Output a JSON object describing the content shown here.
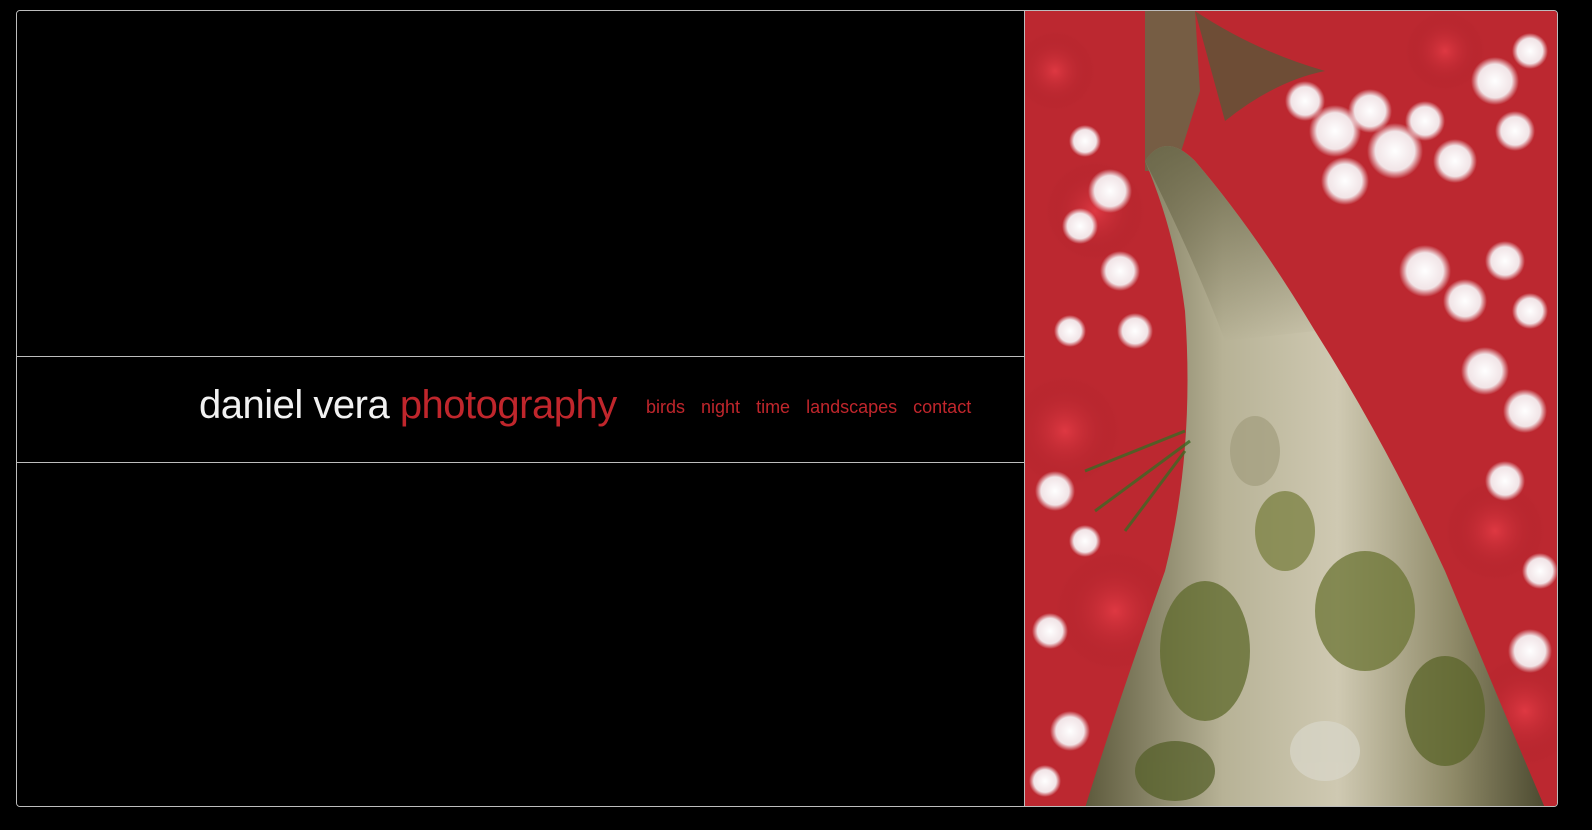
{
  "site": {
    "brand_name": "daniel vera",
    "brand_word": "photography"
  },
  "nav": {
    "items": [
      {
        "label": "birds",
        "name": "nav-link-birds"
      },
      {
        "label": "night",
        "name": "nav-link-night"
      },
      {
        "label": "time",
        "name": "nav-link-time"
      },
      {
        "label": "landscapes",
        "name": "nav-link-landscapes"
      },
      {
        "label": "contact",
        "name": "nav-link-contact"
      }
    ]
  },
  "colors": {
    "background": "#000000",
    "accent_red": "#c0262c",
    "brand_white": "#f2f2f2",
    "rule": "#bdbdbd"
  },
  "photo": {
    "subject": "tree-trunk-red-foliage-bokeh"
  }
}
